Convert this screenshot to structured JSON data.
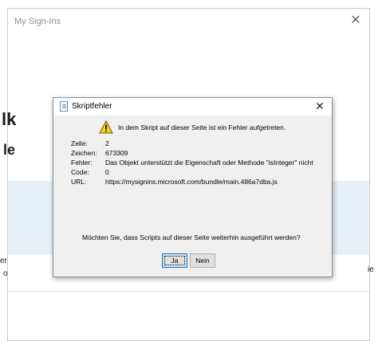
{
  "outer_window": {
    "title": "My Sign-Ins",
    "close_glyph": "✕",
    "background_fragments": {
      "heading_fragment": "lk",
      "subheading_fragment": "le",
      "text_fragment_left_1": "er",
      "text_fragment_left_2": "o",
      "text_fragment_right": "ie"
    }
  },
  "dialog": {
    "title": "Skriptfehler",
    "close_glyph": "✕",
    "icons": {
      "title_icon": "document-icon",
      "message_icon": "warning-icon"
    },
    "headline": "In dem Skript auf dieser Seite ist ein Fehler aufgetreten.",
    "details": [
      {
        "label": "Zeile:",
        "value": "2"
      },
      {
        "label": "Zeichen:",
        "value": "673309"
      },
      {
        "label": "Fehler:",
        "value": "Das Objekt unterstützt die Eigenschaft oder Methode \"isInteger\" nicht"
      },
      {
        "label": "Code:",
        "value": "0"
      },
      {
        "label": "URL:",
        "value": "https://mysignins.microsoft.com/bundle/main.486a7dba.js"
      }
    ],
    "question": "Möchten Sie, dass Scripts auf dieser Seite weiterhin ausgeführt werden?",
    "buttons": {
      "yes": "Ja",
      "no": "Nein"
    }
  },
  "colors": {
    "warning_yellow": "#f7d11e",
    "dialog_background": "#f0f0f0",
    "focus_border": "#0078d7"
  }
}
